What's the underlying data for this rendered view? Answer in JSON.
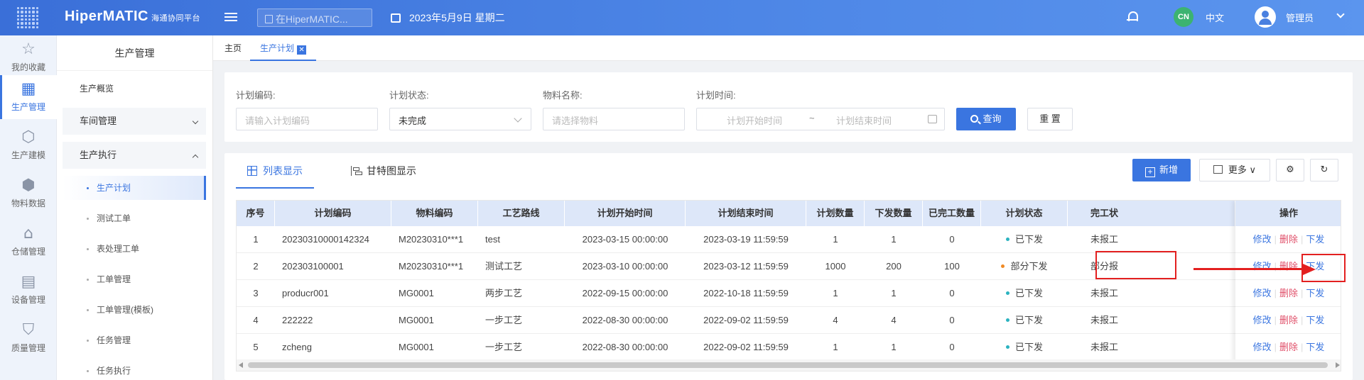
{
  "topbar": {
    "logo": "HiperMATIC",
    "logo_sub": "海通协同平台",
    "search_placeholder": "在HiperMATIC...",
    "date": "2023年5月9日 星期二",
    "lang_badge": "CN",
    "lang": "中文",
    "user": "管理员"
  },
  "rail": [
    {
      "label": "我的收藏",
      "icon": "star-icon",
      "glyph": "☆"
    },
    {
      "label": "生产管理",
      "icon": "production-icon",
      "glyph": "▦"
    },
    {
      "label": "生产建模",
      "icon": "cube-icon",
      "glyph": "⬡"
    },
    {
      "label": "物料数据",
      "icon": "box-settings-icon",
      "glyph": "⬢"
    },
    {
      "label": "仓储管理",
      "icon": "warehouse-icon",
      "glyph": "⌂"
    },
    {
      "label": "设备管理",
      "icon": "device-icon",
      "glyph": "▤"
    },
    {
      "label": "质量管理",
      "icon": "shield-check-icon",
      "glyph": "⛉"
    }
  ],
  "sidebar": {
    "title": "生产管理",
    "overview": "生产概览",
    "groups": [
      "车间管理",
      "生产执行"
    ],
    "items": [
      "生产计划",
      "测试工单",
      "表处理工单",
      "工单管理",
      "工单管理(模板)",
      "任务管理",
      "任务执行"
    ]
  },
  "tabs": [
    "主页",
    "生产计划"
  ],
  "filter": {
    "plan_code_label": "计划编码:",
    "plan_code_placeholder": "请输入计划编码",
    "status_label": "计划状态:",
    "status_value": "未完成",
    "material_label": "物料名称:",
    "material_placeholder": "请选择物料",
    "time_label": "计划时间:",
    "start_placeholder": "计划开始时间",
    "sep": "~",
    "end_placeholder": "计划结束时间",
    "query": "查询",
    "reset": "重 置"
  },
  "panel": {
    "view_list": "列表显示",
    "view_gantt": "甘特图显示",
    "add": "新增",
    "more": "更多"
  },
  "table": {
    "headers": [
      "序号",
      "计划编码",
      "物料编码",
      "工艺路线",
      "计划开始时间",
      "计划结束时间",
      "计划数量",
      "下发数量",
      "已完工数量",
      "计划状态",
      "完工状",
      "操作"
    ],
    "rows": [
      [
        "1",
        "20230310000142324",
        "M20230310***1",
        "test",
        "2023-03-15 00:00:00",
        "2023-03-19 11:59:59",
        "1",
        "1",
        "0",
        "已下发",
        "未报工"
      ],
      [
        "2",
        "202303100001",
        "M20230310***1",
        "测试工艺",
        "2023-03-10 00:00:00",
        "2023-03-12 11:59:59",
        "1000",
        "200",
        "100",
        "部分下发",
        "部分报"
      ],
      [
        "3",
        "producr001",
        "MG0001",
        "两步工艺",
        "2022-09-15 00:00:00",
        "2022-10-18 11:59:59",
        "1",
        "1",
        "0",
        "已下发",
        "未报工"
      ],
      [
        "4",
        "222222",
        "MG0001",
        "一步工艺",
        "2022-08-30 00:00:00",
        "2022-09-02 11:59:59",
        "4",
        "4",
        "0",
        "已下发",
        "未报工"
      ],
      [
        "5",
        "zcheng",
        "MG0001",
        "一步工艺",
        "2022-08-30 00:00:00",
        "2022-09-02 11:59:59",
        "1",
        "1",
        "0",
        "已下发",
        "未报工"
      ]
    ],
    "status_colors": {
      "已下发": "#2bb3c0",
      "部分下发": "#f08a24"
    },
    "ops": {
      "edit": "修改",
      "delete": "删除",
      "issue": "下发"
    }
  },
  "colors": {
    "primary": "#3a75e0",
    "annotation": "#e32020",
    "danger": "#e0506a"
  }
}
